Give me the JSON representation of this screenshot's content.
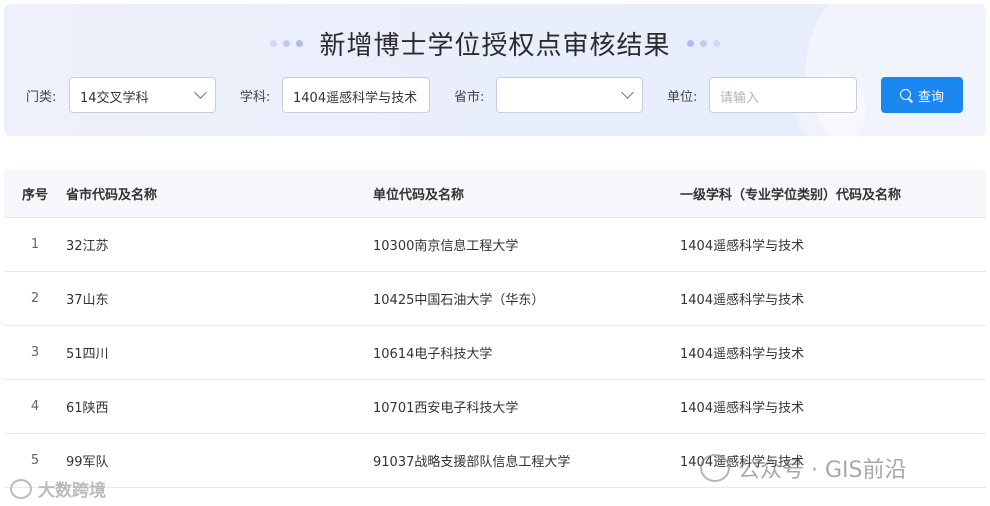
{
  "header": {
    "title": "新增博士学位授权点审核结果"
  },
  "filters": {
    "category": {
      "label": "门类:",
      "value": "14交叉学科"
    },
    "subject": {
      "label": "学科:",
      "value": "1404遥感科学与技术"
    },
    "province": {
      "label": "省市:",
      "value": ""
    },
    "unit": {
      "label": "单位:",
      "placeholder": "请输入"
    },
    "search_label": "查询"
  },
  "table": {
    "columns": [
      "序号",
      "省市代码及名称",
      "单位代码及名称",
      "一级学科（专业学位类别）代码及名称"
    ],
    "rows": [
      [
        "1",
        "32江苏",
        "10300南京信息工程大学",
        "1404遥感科学与技术"
      ],
      [
        "2",
        "37山东",
        "10425中国石油大学（华东）",
        "1404遥感科学与技术"
      ],
      [
        "3",
        "51四川",
        "10614电子科技大学",
        "1404遥感科学与技术"
      ],
      [
        "4",
        "61陕西",
        "10701西安电子科技大学",
        "1404遥感科学与技术"
      ],
      [
        "5",
        "99军队",
        "91037战略支援部队信息工程大学",
        "1404遥感科学与技术"
      ]
    ]
  },
  "watermarks": {
    "left": "大数跨境",
    "right": "公众号 · GIS前沿"
  },
  "colors": {
    "primary": "#1a86f0",
    "banner_bg": "#eef1fb"
  }
}
